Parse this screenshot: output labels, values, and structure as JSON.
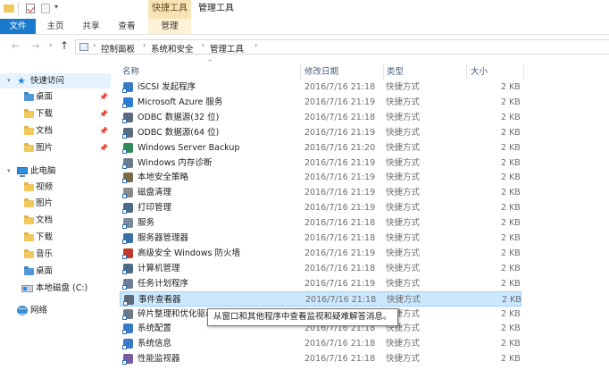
{
  "window": {
    "title": "管理工具",
    "contextual_tab_header": "快捷工具"
  },
  "ribbon": {
    "tabs": {
      "file": "文件",
      "home": "主页",
      "share": "共享",
      "view": "查看",
      "manage": "管理"
    }
  },
  "address": {
    "crumbs": [
      "控制面板",
      "系统和安全",
      "管理工具"
    ],
    "separator": "›"
  },
  "sidebar": {
    "quick_access": {
      "label": "快速访问",
      "items": [
        "桌面",
        "下载",
        "文档",
        "图片"
      ]
    },
    "this_pc": {
      "label": "此电脑",
      "items": [
        "视频",
        "图片",
        "文档",
        "下载",
        "音乐",
        "桌面",
        "本地磁盘 (C:)"
      ]
    },
    "network": {
      "label": "网络"
    }
  },
  "columns": {
    "name": "名称",
    "date": "修改日期",
    "type": "类型",
    "size": "大小"
  },
  "files": [
    {
      "name": "iSCSI 发起程序",
      "date": "2016/7/16 21:18",
      "type": "快捷方式",
      "size": "2 KB",
      "icon_color": "#3a7bc8"
    },
    {
      "name": "Microsoft Azure 服务",
      "date": "2016/7/16 21:19",
      "type": "快捷方式",
      "size": "2 KB",
      "icon_color": "#2b7cd3"
    },
    {
      "name": "ODBC 数据源(32 位)",
      "date": "2016/7/16 21:18",
      "type": "快捷方式",
      "size": "2 KB",
      "icon_color": "#5a6c82"
    },
    {
      "name": "ODBC 数据源(64 位)",
      "date": "2016/7/16 21:19",
      "type": "快捷方式",
      "size": "2 KB",
      "icon_color": "#5a6c82"
    },
    {
      "name": "Windows Server Backup",
      "date": "2016/7/16 21:20",
      "type": "快捷方式",
      "size": "2 KB",
      "icon_color": "#2e8b57"
    },
    {
      "name": "Windows 内存诊断",
      "date": "2016/7/16 21:19",
      "type": "快捷方式",
      "size": "2 KB",
      "icon_color": "#6b7b8c"
    },
    {
      "name": "本地安全策略",
      "date": "2016/7/16 21:19",
      "type": "快捷方式",
      "size": "2 KB",
      "icon_color": "#7a6a4a"
    },
    {
      "name": "磁盘清理",
      "date": "2016/7/16 21:19",
      "type": "快捷方式",
      "size": "2 KB",
      "icon_color": "#8a8a8a"
    },
    {
      "name": "打印管理",
      "date": "2016/7/16 21:19",
      "type": "快捷方式",
      "size": "2 KB",
      "icon_color": "#4a6a8a"
    },
    {
      "name": "服务",
      "date": "2016/7/16 21:18",
      "type": "快捷方式",
      "size": "2 KB",
      "icon_color": "#7a8a9a"
    },
    {
      "name": "服务器管理器",
      "date": "2016/7/16 21:18",
      "type": "快捷方式",
      "size": "2 KB",
      "icon_color": "#3b6ea5"
    },
    {
      "name": "高级安全 Windows 防火墙",
      "date": "2016/7/16 21:19",
      "type": "快捷方式",
      "size": "2 KB",
      "icon_color": "#c0392b"
    },
    {
      "name": "计算机管理",
      "date": "2016/7/16 21:18",
      "type": "快捷方式",
      "size": "2 KB",
      "icon_color": "#4a6a8a"
    },
    {
      "name": "任务计划程序",
      "date": "2016/7/16 21:19",
      "type": "快捷方式",
      "size": "2 KB",
      "icon_color": "#6a7f95"
    },
    {
      "name": "事件查看器",
      "date": "2016/7/16 21:18",
      "type": "快捷方式",
      "size": "2 KB",
      "icon_color": "#5b6b7b",
      "selected": true
    },
    {
      "name": "碎片整理和优化驱动器",
      "date": "2016/7/16 21:19",
      "type": "快捷方式",
      "size": "2 KB",
      "icon_color": "#6a7a8a"
    },
    {
      "name": "系统配置",
      "date": "2016/7/16 21:18",
      "type": "快捷方式",
      "size": "2 KB",
      "icon_color": "#3a7bc8"
    },
    {
      "name": "系统信息",
      "date": "2016/7/16 21:18",
      "type": "快捷方式",
      "size": "2 KB",
      "icon_color": "#3a7bc8"
    },
    {
      "name": "性能监视器",
      "date": "2016/7/16 21:18",
      "type": "快捷方式",
      "size": "2 KB",
      "icon_color": "#7a5aa0"
    }
  ],
  "tooltip": "从窗口和其他程序中查看监视和疑难解答消息。",
  "colors": {
    "accent": "#1979ca",
    "selection": "#cce8ff",
    "context_tab": "#f9e3b5"
  }
}
